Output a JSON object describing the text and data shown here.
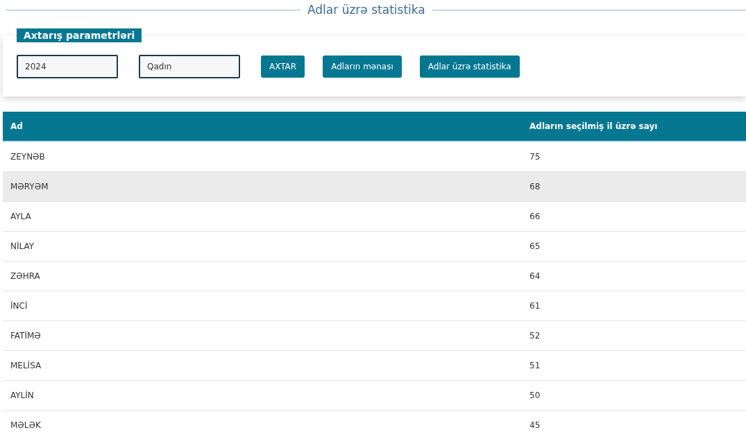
{
  "page_title": "Adlar üzrə statistika",
  "search_panel": {
    "legend": "Axtarış parametrləri",
    "fields": [
      {
        "value": "2024"
      },
      {
        "value": "Qadın"
      }
    ],
    "buttons": [
      "AXTAR",
      "Adların mənası",
      "Adlar üzrə statistika"
    ]
  },
  "table": {
    "columns": [
      "Ad",
      "Adların seçilmiş il üzrə sayı"
    ],
    "rows": [
      {
        "cells": [
          "ZEYNƏB",
          "75"
        ],
        "highlighted": false
      },
      {
        "cells": [
          "MƏRYƏM",
          "68"
        ],
        "highlighted": true
      },
      {
        "cells": [
          "AYLA",
          "66"
        ],
        "highlighted": false
      },
      {
        "cells": [
          "NİLAY",
          "65"
        ],
        "highlighted": false
      },
      {
        "cells": [
          "ZƏHRA",
          "64"
        ],
        "highlighted": false
      },
      {
        "cells": [
          "İNCİ",
          "61"
        ],
        "highlighted": false
      },
      {
        "cells": [
          "FATİMƏ",
          "52"
        ],
        "highlighted": false
      },
      {
        "cells": [
          "MELİSA",
          "51"
        ],
        "highlighted": false
      },
      {
        "cells": [
          "AYLİN",
          "50"
        ],
        "highlighted": false
      },
      {
        "cells": [
          "MƏLƏK",
          "45"
        ],
        "highlighted": false
      }
    ]
  }
}
